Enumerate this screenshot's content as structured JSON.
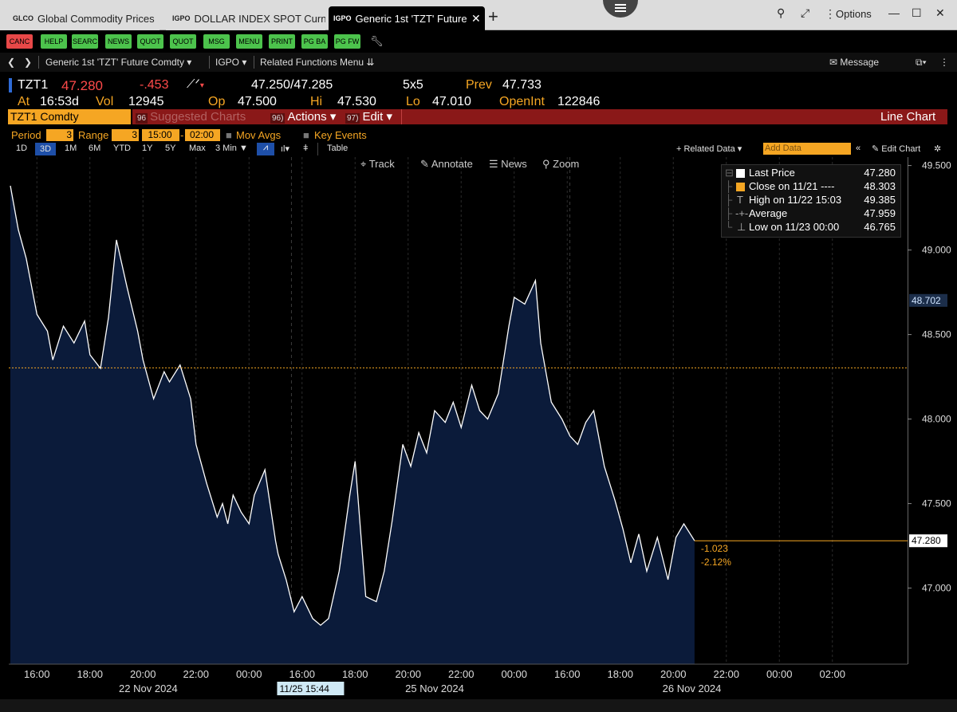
{
  "tabs": [
    {
      "code": "GLCO",
      "label": "Global Commodity Prices"
    },
    {
      "code": "IGPO",
      "label": "DOLLAR INDEX SPOT Curncy"
    },
    {
      "code": "IGPO",
      "label": "Generic 1st 'TZT' Future"
    }
  ],
  "window": {
    "options_label": "Options"
  },
  "toolbar_buttons": [
    "CANC",
    "HELP",
    "SEARC",
    "NEWS",
    "QUOT",
    "QUOT",
    "MSG",
    "MENU",
    "PRINT",
    "PG BA",
    "PG FW"
  ],
  "breadcrumb": {
    "security": "Generic 1st 'TZT' Future Comdty",
    "function": "IGPO",
    "related": "Related Functions Menu",
    "message": "Message"
  },
  "quote": {
    "ticker": "TZT1",
    "last": "47.280",
    "change": "-.453",
    "bid_ask": "47.250/47.285",
    "size": "5x5",
    "prev_label": "Prev",
    "prev": "47.733",
    "at_label": "At",
    "time": "16:53d",
    "vol_label": "Vol",
    "vol": "12945",
    "op_label": "Op",
    "open": "47.500",
    "hi_label": "Hi",
    "high": "47.530",
    "lo_label": "Lo",
    "low": "47.010",
    "oi_label": "OpenInt",
    "open_int": "122846"
  },
  "command_bar": {
    "security": "TZT1 Comdty",
    "suggested_num": "96",
    "suggested": "Suggested Charts",
    "actions_num": "96)",
    "actions": "Actions",
    "edit_num": "97)",
    "edit": "Edit",
    "chart_type": "Line Chart"
  },
  "settings": {
    "period_label": "Period",
    "period_value": "3",
    "range_label": "Range",
    "range_value": "3",
    "time_from": "15:00",
    "time_to": "02:00",
    "mov_avgs": "Mov Avgs",
    "key_events": "Key Events"
  },
  "ranges": [
    "1D",
    "3D",
    "1M",
    "6M",
    "YTD",
    "1Y",
    "5Y",
    "Max"
  ],
  "interval": "3 Min",
  "table_label": "Table",
  "related_data": "+ Related Data",
  "add_data_placeholder": "Add Data",
  "edit_chart": "Edit Chart",
  "chart_tools": [
    "Track",
    "Annotate",
    "News",
    "Zoom"
  ],
  "legend": [
    {
      "label": "Last Price",
      "value": "47.280"
    },
    {
      "label": "Close on 11/21 ----",
      "value": "48.303"
    },
    {
      "label": "High on 11/22 15:03",
      "value": "49.385"
    },
    {
      "label": "Average",
      "value": "47.959"
    },
    {
      "label": "Low on 11/23 00:00",
      "value": "46.765"
    }
  ],
  "change_annotations": {
    "abs": "-1.023",
    "pct": "-2.12%"
  },
  "cursor_label": "11/25 15:44",
  "colors": {
    "accent": "#f5a623",
    "command_bar": "#8a1818",
    "area_fill": "#0b1b3a",
    "line": "#ffffff",
    "down": "#ff4a4a"
  },
  "chart_data": {
    "type": "area",
    "title": "",
    "xlabel": "",
    "ylabel": "",
    "ylim": [
      46.55,
      49.55
    ],
    "y_ticks": [
      "49.500",
      "49.000",
      "48.500",
      "48.000",
      "47.500",
      "47.000"
    ],
    "y_tick_values": [
      49.5,
      49.0,
      48.5,
      48.0,
      47.5,
      47.0
    ],
    "x_tick_labels": [
      "16:00",
      "18:00",
      "20:00",
      "22:00",
      "00:00",
      "16:00",
      "18:00",
      "20:00",
      "22:00",
      "00:00",
      "16:00",
      "18:00",
      "20:00",
      "22:00",
      "00:00",
      "02:00"
    ],
    "date_labels": [
      "22 Nov 2024",
      "25 Nov 2024",
      "26 Nov 2024"
    ],
    "reference_line": {
      "label": "Close on 11/21",
      "value": 48.303
    },
    "last_price": {
      "value": 47.28,
      "label": "47.280"
    },
    "cursor_value": {
      "value": 48.702,
      "label": "48.702"
    },
    "series": [
      {
        "name": "Last Price",
        "x": [
          0,
          0.15,
          0.3,
          0.5,
          0.7,
          0.8,
          1.0,
          1.2,
          1.4,
          1.5,
          1.7,
          1.85,
          2.0,
          2.2,
          2.4,
          2.5,
          2.7,
          2.9,
          3.0,
          3.2,
          3.4,
          3.5,
          3.7,
          3.9,
          4.0,
          4.1,
          4.2,
          4.35,
          4.5,
          4.6,
          4.8,
          5.0,
          5.05,
          5.2,
          5.35,
          5.5,
          5.7,
          5.85,
          6.0,
          6.2,
          6.4,
          6.5,
          6.7,
          6.9,
          7.05,
          7.2,
          7.4,
          7.55,
          7.7,
          7.85,
          8.0,
          8.2,
          8.35,
          8.5,
          8.7,
          8.85,
          9.0,
          9.2,
          9.4,
          9.5,
          9.7,
          9.9,
          10.0,
          10.2,
          10.4,
          10.55,
          10.7,
          10.85,
          11.0,
          11.2,
          11.4,
          11.55,
          11.7,
          11.85,
          12.0,
          12.2,
          12.4,
          12.55,
          12.7,
          12.9
        ],
        "values": [
          49.38,
          49.12,
          48.95,
          48.62,
          48.52,
          48.35,
          48.55,
          48.45,
          48.58,
          48.38,
          48.3,
          48.6,
          49.06,
          48.78,
          48.52,
          48.35,
          48.12,
          48.28,
          48.22,
          48.32,
          48.12,
          47.85,
          47.62,
          47.42,
          47.5,
          47.38,
          47.55,
          47.45,
          47.38,
          47.55,
          47.7,
          47.28,
          47.2,
          47.05,
          46.86,
          46.95,
          46.82,
          46.78,
          46.82,
          47.1,
          47.55,
          47.75,
          46.95,
          46.92,
          47.1,
          47.4,
          47.85,
          47.72,
          47.92,
          47.8,
          48.05,
          47.98,
          48.1,
          47.95,
          48.2,
          48.05,
          48.0,
          48.15,
          48.55,
          48.72,
          48.68,
          48.82,
          48.45,
          48.1,
          48.0,
          47.9,
          47.85,
          47.98,
          48.05,
          47.72,
          47.52,
          47.35,
          47.15,
          47.32,
          47.1,
          47.3,
          47.05,
          47.3,
          47.38,
          47.28
        ]
      }
    ]
  }
}
